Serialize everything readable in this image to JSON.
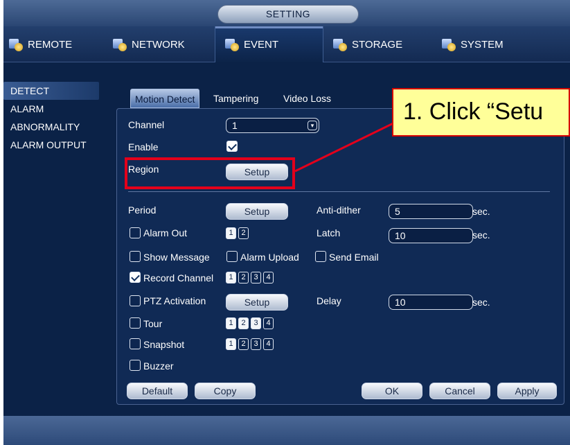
{
  "title": "SETTING",
  "main_tabs": [
    {
      "label": "REMOTE",
      "icon": "remote-gear-icon"
    },
    {
      "label": "NETWORK",
      "icon": "network-gear-icon"
    },
    {
      "label": "EVENT",
      "icon": "event-gear-icon"
    },
    {
      "label": "STORAGE",
      "icon": "storage-gear-icon"
    },
    {
      "label": "SYSTEM",
      "icon": "system-gear-icon"
    }
  ],
  "sidebar": {
    "items": [
      {
        "label": "DETECT"
      },
      {
        "label": "ALARM"
      },
      {
        "label": "ABNORMALITY"
      },
      {
        "label": "ALARM OUTPUT"
      }
    ]
  },
  "sub_tabs": [
    "Motion Detect",
    "Tampering",
    "Video Loss"
  ],
  "form": {
    "channel_label": "Channel",
    "channel_value": "1",
    "enable_label": "Enable",
    "enable_checked": true,
    "region_label": "Region",
    "region_button": "Setup",
    "period_label": "Period",
    "period_button": "Setup",
    "anti_dither_label": "Anti-dither",
    "anti_dither_value": "5",
    "anti_dither_unit": "sec.",
    "alarm_out_label": "Alarm Out",
    "alarm_out_channels": [
      "1",
      "2"
    ],
    "latch_label": "Latch",
    "latch_value": "10",
    "latch_unit": "sec.",
    "show_message_label": "Show Message",
    "alarm_upload_label": "Alarm Upload",
    "send_email_label": "Send Email",
    "record_channel_label": "Record Channel",
    "record_channel_checked": true,
    "record_channels": [
      "1",
      "2",
      "3",
      "4"
    ],
    "ptz_activation_label": "PTZ Activation",
    "ptz_button": "Setup",
    "delay_label": "Delay",
    "delay_value": "10",
    "delay_unit": "sec.",
    "tour_label": "Tour",
    "tour_channels": [
      "1",
      "2",
      "3",
      "4"
    ],
    "snapshot_label": "Snapshot",
    "snapshot_channels": [
      "1",
      "2",
      "3",
      "4"
    ],
    "buzzer_label": "Buzzer"
  },
  "footer_buttons": {
    "default": "Default",
    "copy": "Copy",
    "ok": "OK",
    "cancel": "Cancel",
    "apply": "Apply"
  },
  "annotation": {
    "callout_text": "1. Click “Setu"
  },
  "colors": {
    "background": "#0b2247",
    "callout_fill": "#ffff99",
    "highlight_red": "#e3001b"
  }
}
